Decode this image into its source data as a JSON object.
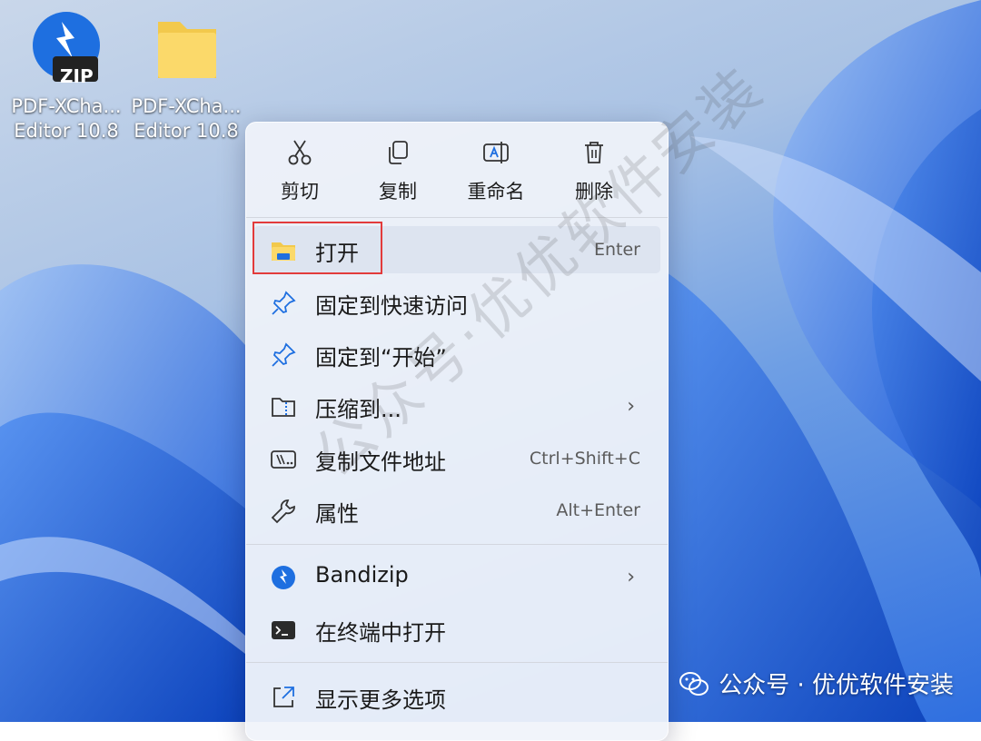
{
  "desktop": {
    "icons": [
      {
        "label_line1": "PDF-XCha...",
        "label_line2": "Editor 10.8",
        "badge": "ZIP",
        "icon": "bandizip-zip-icon"
      },
      {
        "label_line1": "PDF-XCha...",
        "label_line2": "Editor 10.8",
        "icon": "folder-icon"
      }
    ]
  },
  "menu": {
    "toolbar": [
      {
        "label": "剪切",
        "icon": "scissors-icon"
      },
      {
        "label": "复制",
        "icon": "copy-icon"
      },
      {
        "label": "重命名",
        "icon": "rename-icon"
      },
      {
        "label": "删除",
        "icon": "trash-icon"
      }
    ],
    "items": [
      {
        "label": "打开",
        "shortcut": "Enter",
        "icon": "folder-open-icon"
      },
      {
        "label": "固定到快速访问",
        "shortcut": "",
        "icon": "pin-icon"
      },
      {
        "label": "固定到“开始”",
        "shortcut": "",
        "icon": "pin-icon"
      },
      {
        "label": "压缩到...",
        "chevron": "›",
        "icon": "compress-icon"
      },
      {
        "label": "复制文件地址",
        "shortcut": "Ctrl+Shift+C",
        "icon": "copy-path-icon"
      },
      {
        "label": "属性",
        "shortcut": "Alt+Enter",
        "icon": "wrench-icon"
      },
      {
        "label": "Bandizip",
        "chevron": "›",
        "icon": "bandizip-icon"
      },
      {
        "label": "在终端中打开",
        "shortcut": "",
        "icon": "terminal-icon"
      },
      {
        "label": "显示更多选项",
        "shortcut": "",
        "icon": "share-icon"
      }
    ]
  },
  "watermark": {
    "diagonal": "公众号·优优软件安装",
    "badge_text": "公众号 · 优优软件安装"
  },
  "colors": {
    "highlight_box": "#e23b3b",
    "accent_blue": "#1e6fe0"
  }
}
